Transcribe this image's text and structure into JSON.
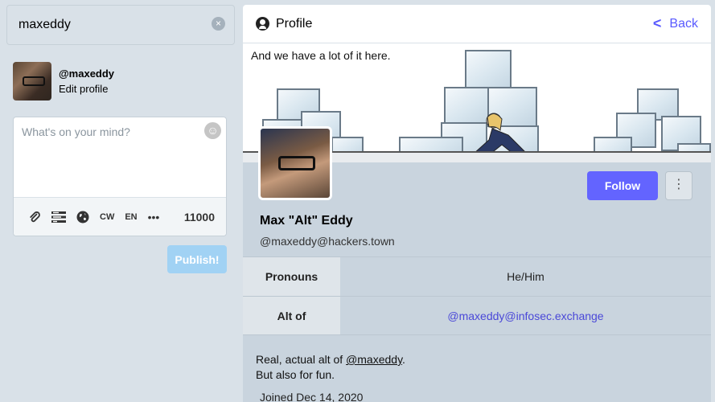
{
  "search": {
    "value": "maxeddy",
    "clear_icon": "×"
  },
  "nav_profile": {
    "acct": "@maxeddy",
    "edit_label": "Edit profile"
  },
  "compose": {
    "placeholder": "What's on your mind?",
    "emoji_icon": "laughing-emoji-icon",
    "toolbar": {
      "attach_icon": "paperclip-icon",
      "poll_icon": "poll-icon",
      "visibility_icon": "globe-icon",
      "cw_label": "CW",
      "language_label": "EN",
      "more_icon": "ellipsis-icon"
    },
    "counter": "11000",
    "publish_label": "Publish!"
  },
  "column": {
    "title": "Profile",
    "back_label": "Back"
  },
  "profile": {
    "header_caption": "And we have a lot of it here.",
    "display_name": "Max \"Alt\" Eddy",
    "handle": "@maxeddy@hackers.town",
    "follow_label": "Follow",
    "fields": [
      {
        "name": "Pronouns",
        "value": "He/Him"
      },
      {
        "name": "Alt of",
        "value": "@maxeddy@infosec.exchange"
      }
    ],
    "bio_prefix": "Real, actual alt of ",
    "bio_mention": "@maxeddy",
    "bio_suffix": ".",
    "bio_line2": "But also for fun.",
    "joined": "Joined Dec 14, 2020"
  },
  "colors": {
    "accent": "#6364ff",
    "link": "#595aff",
    "publish_disabled": "#a1d2f4"
  }
}
